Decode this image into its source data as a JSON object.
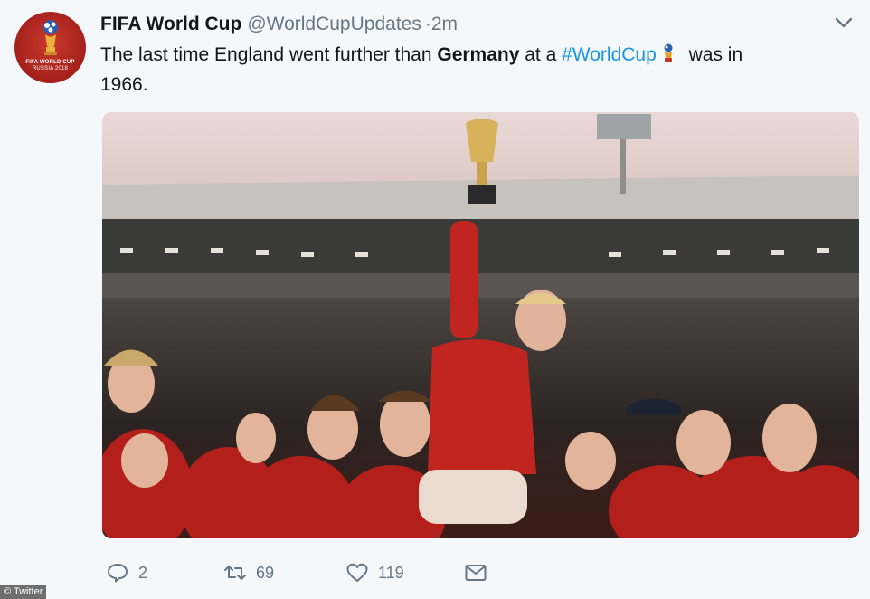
{
  "tweet": {
    "author_name": "FIFA World Cup",
    "handle": "@WorldCupUpdates",
    "separator": "·",
    "time": "2m",
    "avatar_text_line1": "FIFA WORLD CUP",
    "avatar_text_line2": "RUSSIA 2018",
    "text_part1": "The last time England went further than ",
    "text_bold": "Germany",
    "text_part2": " at a ",
    "hashtag": "#WorldCup",
    "text_part3": " was in",
    "text_line2": "1966.",
    "media_description_icon": "photo"
  },
  "actions": {
    "reply_count": "2",
    "retweet_count": "69",
    "like_count": "119"
  },
  "watermark": "© Twitter",
  "colors": {
    "background": "#f5f8fa",
    "link": "#1b95e0",
    "secondary_text": "#657786",
    "avatar_red": "#a4201b"
  }
}
